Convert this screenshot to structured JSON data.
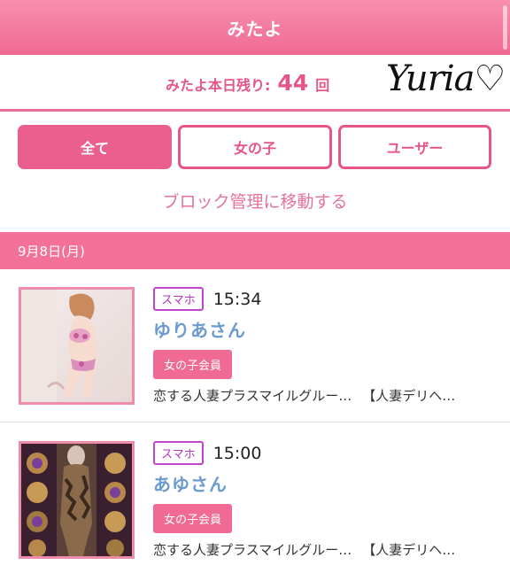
{
  "header": {
    "title": "みたよ"
  },
  "remain": {
    "label": "みたよ本日残り:",
    "count": "44",
    "unit": "回"
  },
  "signature": "Yuria♡",
  "tabs": [
    {
      "label": "全て",
      "active": true
    },
    {
      "label": "女の子",
      "active": false
    },
    {
      "label": "ユーザー",
      "active": false
    }
  ],
  "block_link": "ブロック管理に移動する",
  "date": "9月8日(月)",
  "entries": [
    {
      "device": "スマホ",
      "time": "15:34",
      "name": "ゆりあさん",
      "member_type": "女の子会員",
      "shop": "恋する人妻プラスマイルグルー…",
      "category": "【人妻デリヘ…"
    },
    {
      "device": "スマホ",
      "time": "15:00",
      "name": "あゆさん",
      "member_type": "女の子会員",
      "shop": "恋する人妻プラスマイルグルー…",
      "category": "【人妻デリヘ…"
    }
  ],
  "colors": {
    "accent": "#f06a93",
    "link": "#e5729a",
    "name": "#6a9ad0",
    "device_badge": "#c145c8"
  }
}
